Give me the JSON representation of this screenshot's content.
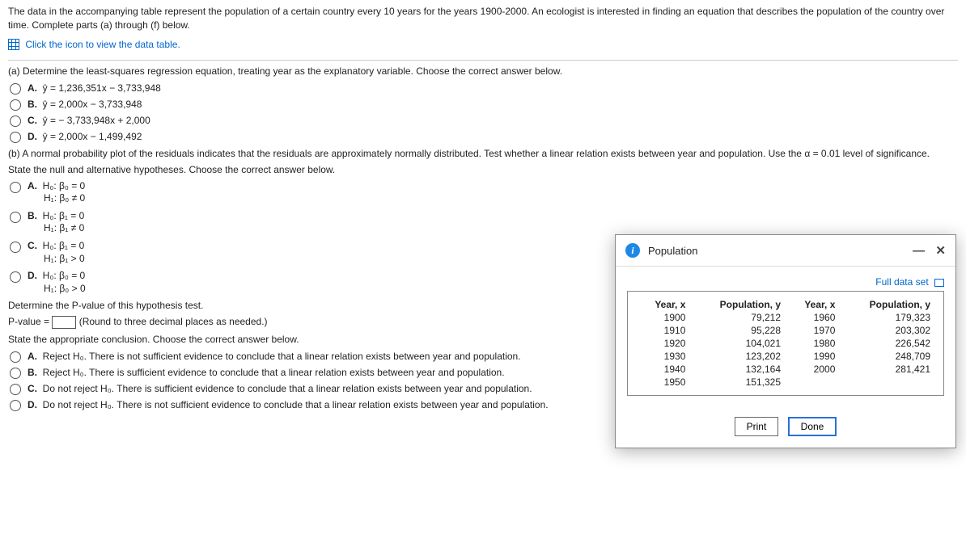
{
  "intro": "The data in the accompanying table represent the population of a certain country every 10 years for the years 1900-2000. An ecologist is interested in finding an equation that describes the population of the country over time. Complete parts (a) through (f) below.",
  "table_link": "Click the icon to view the data table.",
  "part_a": {
    "prompt": "(a) Determine the least-squares regression equation, treating year as the explanatory variable. Choose the correct answer below.",
    "opts": {
      "A": "ŷ = 1,236,351x − 3,733,948",
      "B": "ŷ = 2,000x − 3,733,948",
      "C": "ŷ = − 3,733,948x + 2,000",
      "D": "ŷ = 2,000x − 1,499,492"
    }
  },
  "part_b": {
    "prompt": "(b) A normal probability plot of the residuals indicates that the residuals are approximately normally distributed. Test whether a linear relation exists between year and population. Use the α = 0.01 level of significance.",
    "state": "State the null and alternative hypotheses. Choose the correct answer below.",
    "opts": {
      "A": {
        "h0": "H₀: β₀ = 0",
        "h1": "H₁: β₀ ≠ 0"
      },
      "B": {
        "h0": "H₀: β₁ = 0",
        "h1": "H₁: β₁ ≠ 0"
      },
      "C": {
        "h0": "H₀: β₁ = 0",
        "h1": "H₁: β₁ > 0"
      },
      "D": {
        "h0": "H₀: β₀ = 0",
        "h1": "H₁: β₀ > 0"
      }
    }
  },
  "pvalue": {
    "label1": "Determine the P-value of this hypothesis test.",
    "label2a": "P-value =",
    "label2b": "(Round to three decimal places as needed.)"
  },
  "conclusion": {
    "prompt": "State the appropriate conclusion. Choose the correct answer below.",
    "opts": {
      "A": "Reject H₀. There is not sufficient evidence to conclude that a linear relation exists between year and population.",
      "B": "Reject H₀. There is sufficient evidence to conclude that a linear relation exists between year and population.",
      "C": "Do not reject H₀. There is sufficient evidence to conclude that a linear relation exists between year and population.",
      "D": "Do not reject H₀. There is not sufficient evidence to conclude that a linear relation exists between year and population."
    }
  },
  "modal": {
    "title": "Population",
    "full": "Full data set",
    "head_x": "Year, x",
    "head_y": "Population, y",
    "left": [
      {
        "x": "1900",
        "y": "79,212"
      },
      {
        "x": "1910",
        "y": "95,228"
      },
      {
        "x": "1920",
        "y": "104,021"
      },
      {
        "x": "1930",
        "y": "123,202"
      },
      {
        "x": "1940",
        "y": "132,164"
      },
      {
        "x": "1950",
        "y": "151,325"
      }
    ],
    "right": [
      {
        "x": "1960",
        "y": "179,323"
      },
      {
        "x": "1970",
        "y": "203,302"
      },
      {
        "x": "1980",
        "y": "226,542"
      },
      {
        "x": "1990",
        "y": "248,709"
      },
      {
        "x": "2000",
        "y": "281,421"
      }
    ],
    "print": "Print",
    "done": "Done"
  },
  "labels": {
    "A": "A.",
    "B": "B.",
    "C": "C.",
    "D": "D."
  }
}
